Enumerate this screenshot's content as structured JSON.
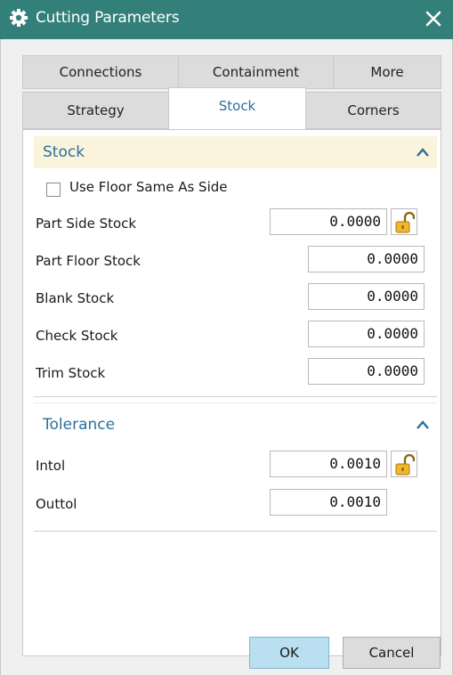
{
  "window": {
    "title": "Cutting Parameters"
  },
  "tabs": {
    "row1": [
      "Connections",
      "Containment",
      "More"
    ],
    "row2": [
      "Strategy",
      "Stock",
      "Corners"
    ],
    "active": "Stock"
  },
  "stock_section": {
    "title": "Stock",
    "use_floor_same_as_side": {
      "label": "Use Floor Same As Side",
      "checked": false
    },
    "fields": [
      {
        "label": "Part Side Stock",
        "value": "0.0000",
        "lock": true
      },
      {
        "label": "Part Floor Stock",
        "value": "0.0000",
        "lock": false
      },
      {
        "label": "Blank Stock",
        "value": "0.0000",
        "lock": false
      },
      {
        "label": "Check Stock",
        "value": "0.0000",
        "lock": false
      },
      {
        "label": "Trim Stock",
        "value": "0.0000",
        "lock": false
      }
    ]
  },
  "tolerance_section": {
    "title": "Tolerance",
    "fields": [
      {
        "label": "Intol",
        "value": "0.0010",
        "lock": true
      },
      {
        "label": "Outtol",
        "value": "0.0010",
        "lock": false
      }
    ]
  },
  "buttons": {
    "ok": "OK",
    "cancel": "Cancel"
  },
  "colors": {
    "titlebar": "#33807a",
    "section_title": "#2a6f9e",
    "section_header_bg": "#fbf4dc",
    "ok_button": "#b9dff0"
  },
  "icons": {
    "title": "gear-icon",
    "close": "close-icon",
    "collapse": "chevron-up-icon",
    "lock": "padlock-open-icon"
  }
}
